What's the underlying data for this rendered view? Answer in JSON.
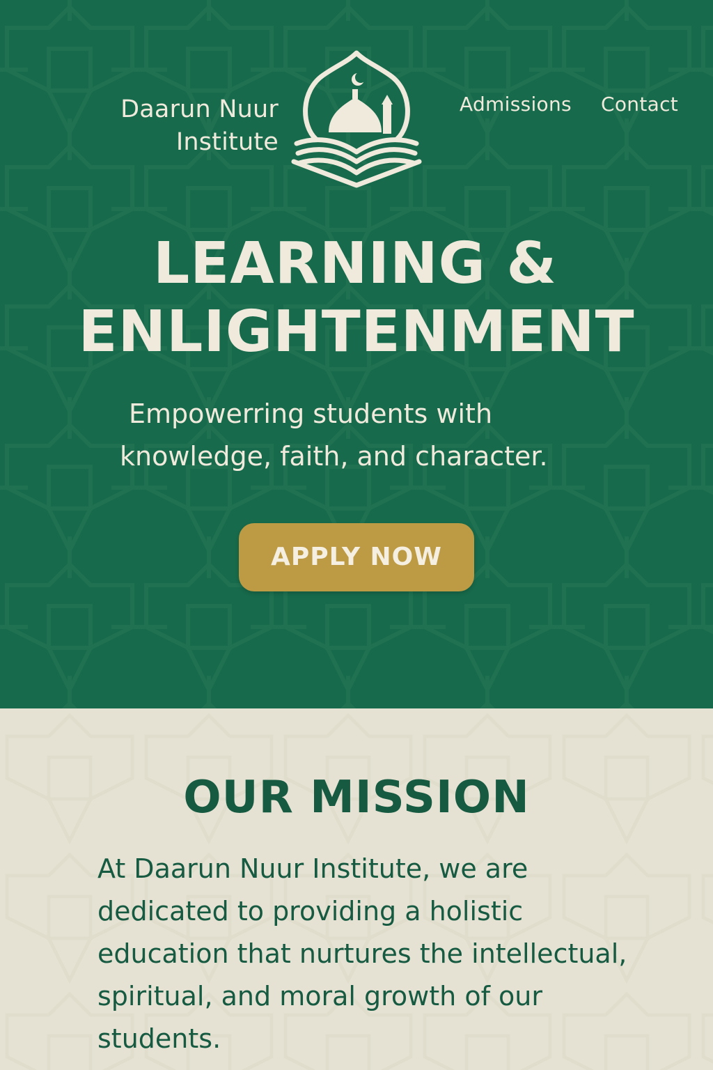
{
  "brand": {
    "name_line_1": "Daarun Nuur",
    "name_line_2": "Institute",
    "logo_icon": "mosque-book-logo-icon"
  },
  "nav": {
    "items": [
      {
        "label": "Admissions"
      },
      {
        "label": "Contact"
      }
    ]
  },
  "hero": {
    "title_line_1": "LEARNING &",
    "title_line_2": "ENLIGHTENMENT",
    "subtitle_line_1": "Empowerring students with",
    "subtitle_line_2": "knowledge, faith, and character.",
    "cta_label": "APPLY NOW"
  },
  "mission": {
    "title": "OUR MISSION",
    "lines": [
      "At Daarun Nuur Institute, we are",
      "dedicated to providing a holistic",
      "education that nurtures the intellectual,",
      "spiritual, and moral growth of our",
      "students."
    ]
  },
  "colors": {
    "hero_background": "#176a4b",
    "cream": "#efeadb",
    "button_gold": "#bd9a44",
    "mission_background": "#e5e2d3",
    "mission_text": "#175a42"
  }
}
